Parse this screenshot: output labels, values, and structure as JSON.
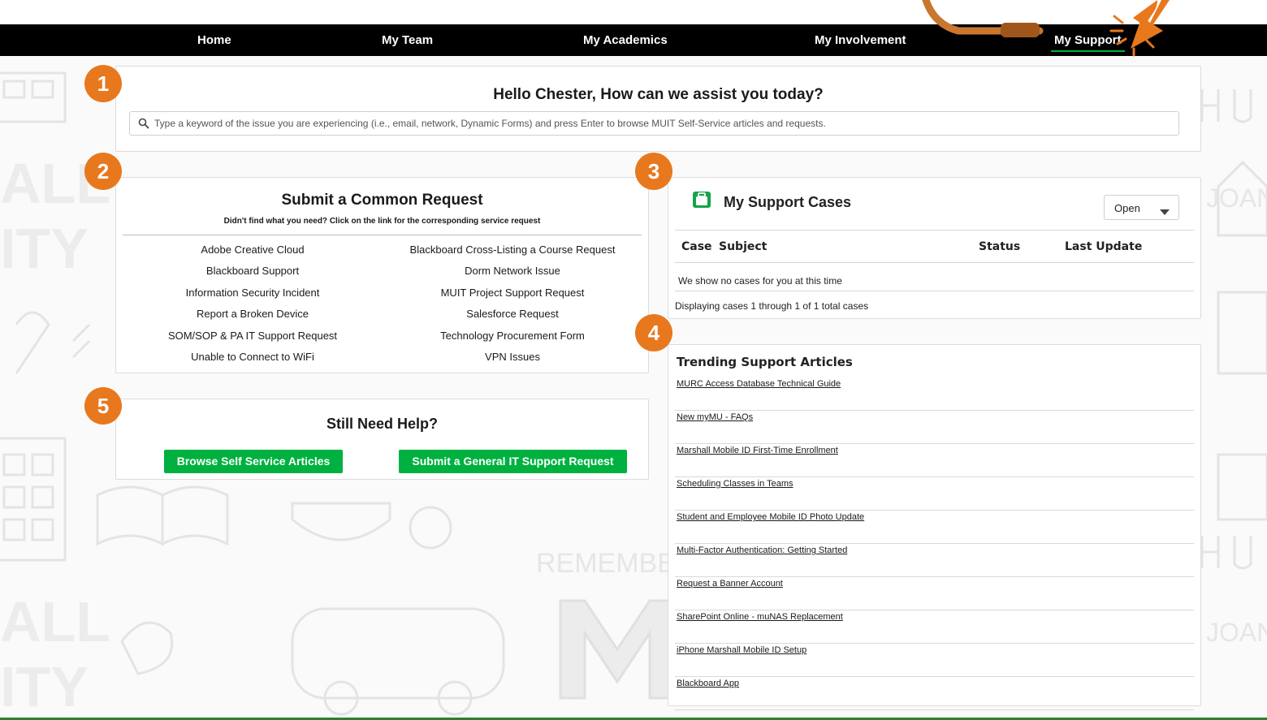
{
  "nav": {
    "items": [
      {
        "label": "Home"
      },
      {
        "label": "My Team"
      },
      {
        "label": "My Academics"
      },
      {
        "label": "My Involvement"
      },
      {
        "label": "My Support",
        "active": true
      }
    ]
  },
  "badges": [
    "1",
    "2",
    "3",
    "4",
    "5"
  ],
  "greeting": {
    "title": "Hello Chester, How can we assist you today?",
    "search_placeholder": "Type a keyword of the issue you are experiencing (i.e., email, network, Dynamic Forms) and press Enter to browse MUIT Self-Service articles and requests."
  },
  "common_requests": {
    "title": "Submit a Common Request",
    "subtitle": "Didn't find what you need? Click on the link for the corresponding service request",
    "left": [
      "Adobe Creative Cloud",
      "Blackboard Support",
      "Information Security Incident",
      "Report a Broken Device",
      "SOM/SOP & PA IT Support Request",
      "Unable to Connect to WiFi"
    ],
    "right": [
      "Blackboard Cross-Listing a Course Request",
      "Dorm Network Issue",
      "MUIT Project Support Request",
      "Salesforce Request",
      "Technology Procurement Form",
      "VPN Issues"
    ]
  },
  "still_help": {
    "title": "Still Need Help?",
    "browse_label": "Browse Self Service Articles",
    "submit_label": "Submit a General IT Support Request"
  },
  "support_cases": {
    "title": "My Support Cases",
    "filter_value": "Open",
    "columns": [
      "Case",
      "Subject",
      "Status",
      "Last Update"
    ],
    "empty_message": "We show no cases for you at this time",
    "count_text": "Displaying cases 1 through 1 of 1 total cases"
  },
  "trending": {
    "title": "Trending Support Articles",
    "articles": [
      "MURC Access Database Technical Guide",
      "New myMU - FAQs",
      "Marshall Mobile ID First-Time Enrollment",
      "Scheduling Classes in Teams",
      "Student and Employee Mobile ID Photo Update",
      "Multi-Factor Authentication: Getting Started",
      "Request a Banner Account",
      "SharePoint Online - muNAS Replacement",
      "iPhone Marshall Mobile ID Setup",
      "Blackboard App"
    ]
  },
  "colors": {
    "accent_green": "#00b140",
    "badge_orange": "#e8781e",
    "nav_bg": "#000000"
  },
  "icons": [
    "search-icon",
    "briefcase-icon",
    "chevron-down-icon",
    "pointer-arrow-icon"
  ]
}
